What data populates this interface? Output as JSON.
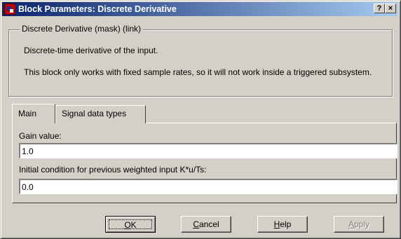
{
  "window": {
    "title": "Block Parameters: Discrete Derivative",
    "help_button": "?",
    "close_button": "×"
  },
  "description": {
    "legend": "Discrete Derivative (mask) (link)",
    "line1": "Discrete-time derivative of the input.",
    "line2": "This block only works with fixed sample rates, so it will not work inside a triggered subsystem."
  },
  "tabs": [
    {
      "label": "Main",
      "selected": true
    },
    {
      "label": "Signal data types",
      "selected": false
    }
  ],
  "main": {
    "gain_label": "Gain value:",
    "gain_value": "1.0",
    "init_label": "Initial condition for previous weighted input K*u/Ts:",
    "init_value": "0.0"
  },
  "buttons": {
    "ok": {
      "pre": "",
      "accel": "O",
      "post": "K"
    },
    "cancel": {
      "pre": "",
      "accel": "C",
      "post": "ancel"
    },
    "help": {
      "pre": "",
      "accel": "H",
      "post": "elp"
    },
    "apply": {
      "pre": "",
      "accel": "A",
      "post": "pply"
    }
  },
  "colors": {
    "face": "#d4d0c8",
    "title_start": "#0a246a",
    "title_end": "#a6caf0"
  }
}
